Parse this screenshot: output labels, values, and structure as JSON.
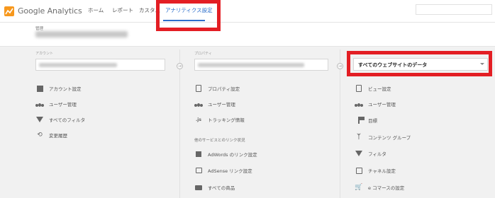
{
  "app": {
    "name": "Google Analytics"
  },
  "nav": {
    "home": "ホーム",
    "reports": "レポート",
    "custom": "カスタム",
    "admin": "アナリティクス設定"
  },
  "admin_header": {
    "label": "管理"
  },
  "account": {
    "label": "アカウント",
    "items": [
      {
        "label": "アカウント設定",
        "icon": "building-icon"
      },
      {
        "label": "ユーザー管理",
        "icon": "users-icon"
      },
      {
        "label": "すべてのフィルタ",
        "icon": "filter-icon"
      },
      {
        "label": "変更履歴",
        "icon": "history-icon"
      }
    ]
  },
  "property": {
    "label": "プロパティ",
    "items": [
      {
        "label": "プロパティ設定",
        "icon": "document-icon"
      },
      {
        "label": "ユーザー管理",
        "icon": "users-icon"
      },
      {
        "label": "トラッキング情報",
        "icon": "js-icon"
      }
    ],
    "section_title": "他のサービスとのリンク状況",
    "link_items": [
      {
        "label": "AdWords のリンク設定",
        "icon": "adwords-icon"
      },
      {
        "label": "AdSense リンク設定",
        "icon": "adsense-icon"
      },
      {
        "label": "すべての商品",
        "icon": "products-icon"
      }
    ]
  },
  "view": {
    "select_value": "すべてのウェブサイトのデータ",
    "items": [
      {
        "label": "ビュー設定",
        "icon": "document-icon"
      },
      {
        "label": "ユーザー管理",
        "icon": "users-icon"
      },
      {
        "label": "目標",
        "icon": "flag-icon"
      },
      {
        "label": "コンテンツ グループ",
        "icon": "person-icon"
      },
      {
        "label": "フィルタ",
        "icon": "filter-icon"
      },
      {
        "label": "チャネル設定",
        "icon": "channel-icon"
      },
      {
        "label": "e コマースの設定",
        "icon": "cart-icon"
      }
    ]
  },
  "colors": {
    "accent": "#2c6ecb",
    "highlight": "#e31e24"
  }
}
